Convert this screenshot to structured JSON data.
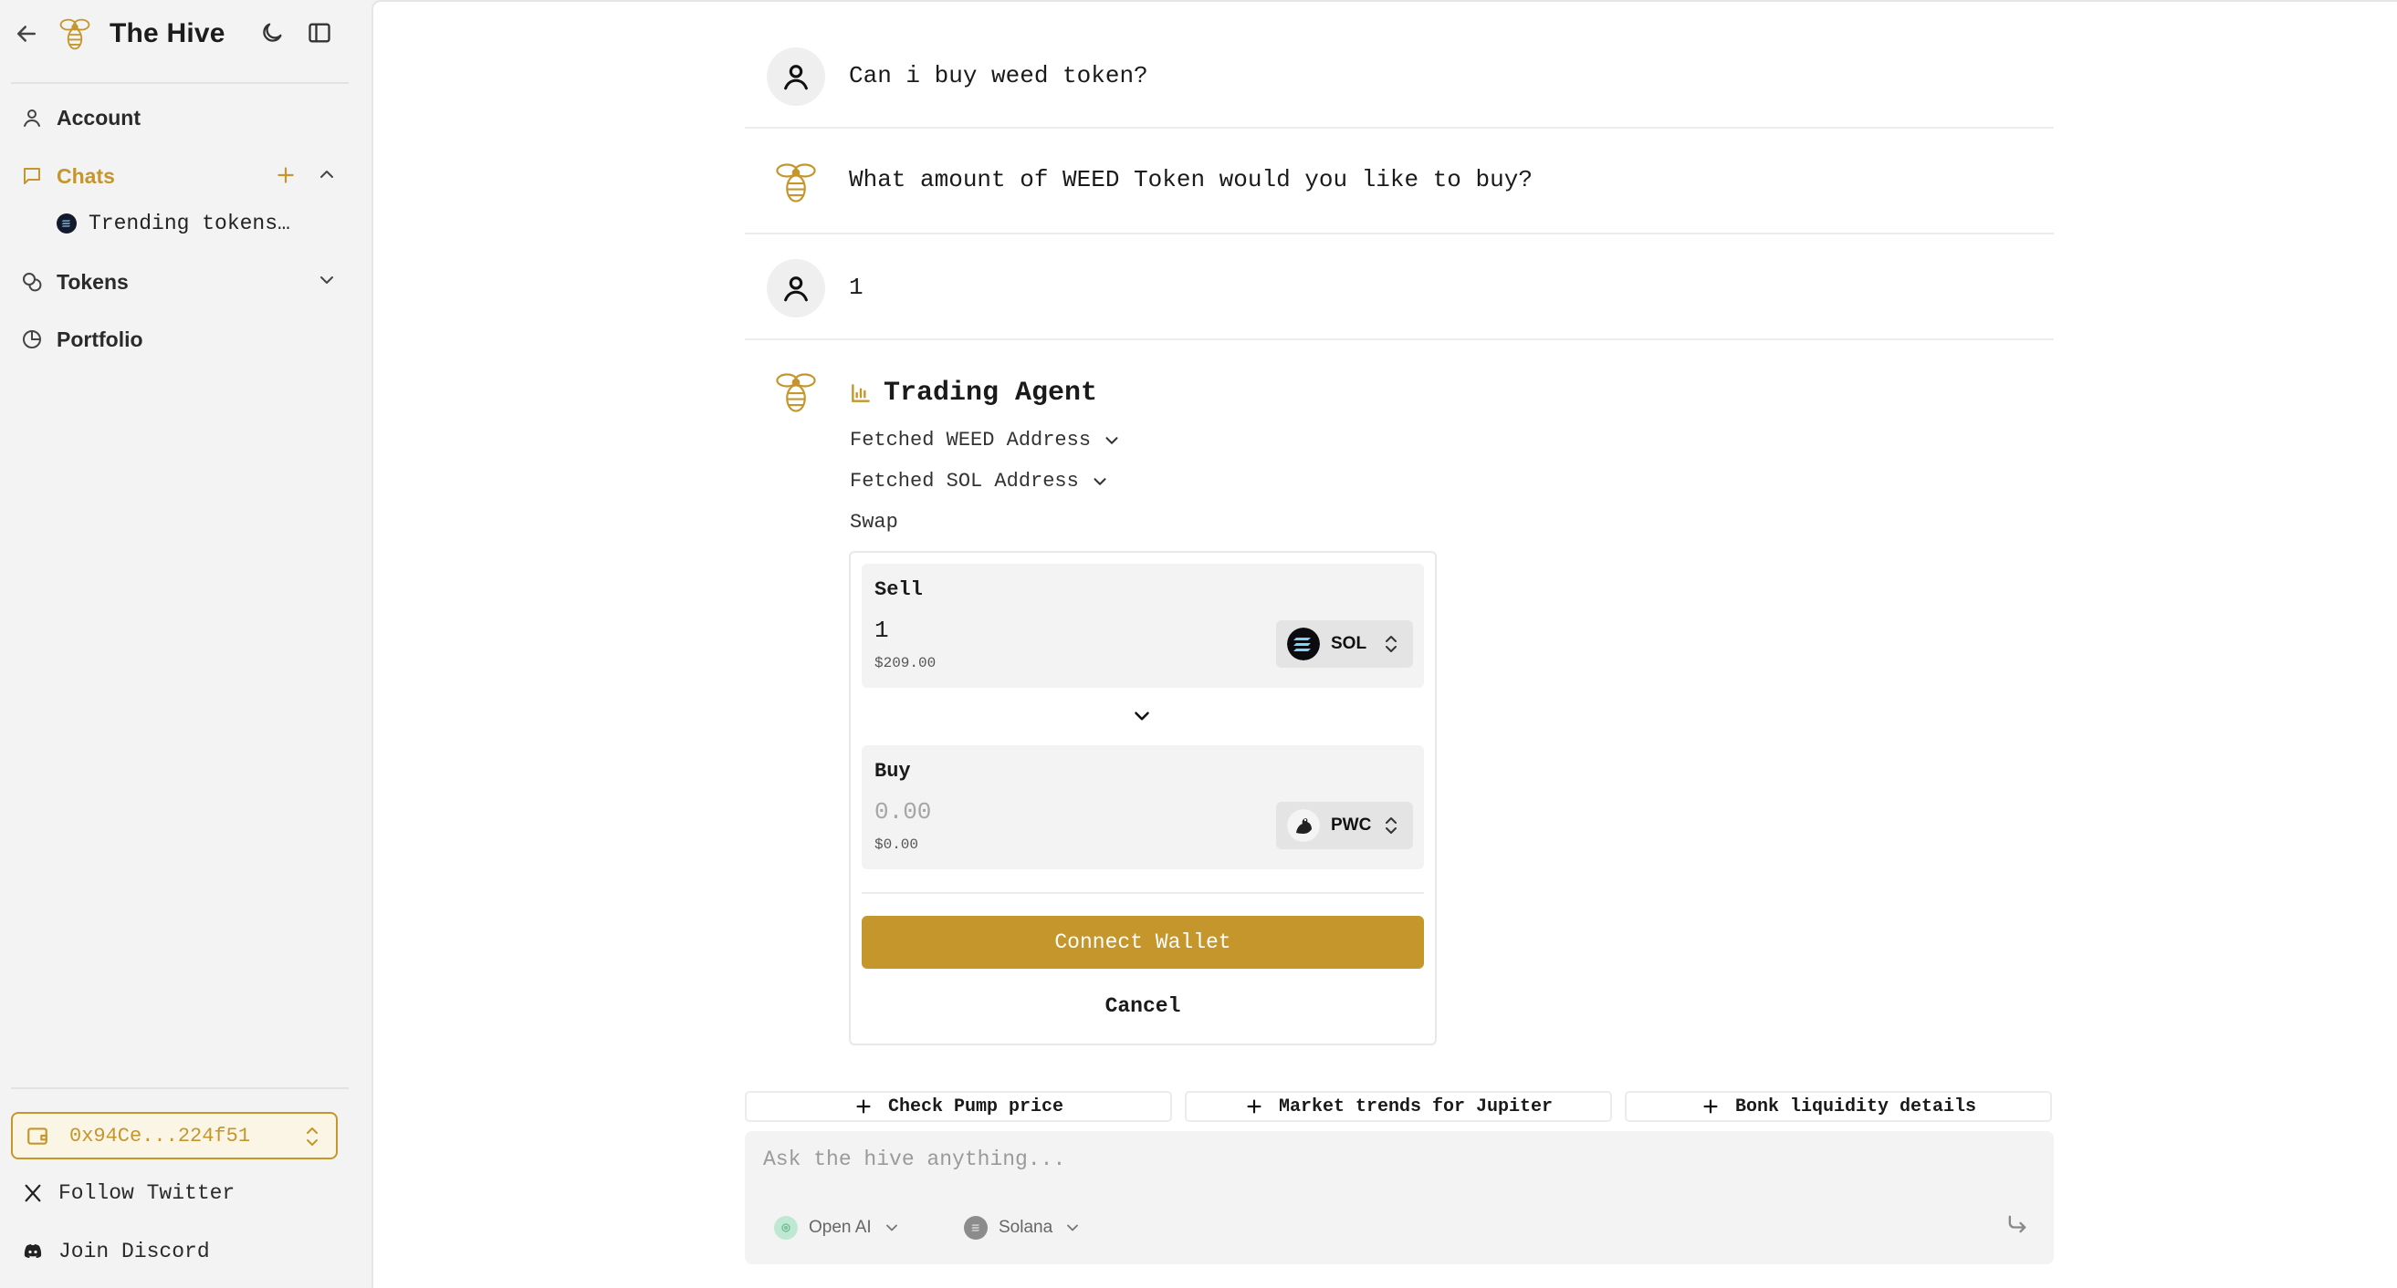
{
  "app": {
    "title": "The Hive"
  },
  "sidebar": {
    "nav": {
      "account": "Account",
      "chats": "Chats",
      "tokens": "Tokens",
      "portfolio": "Portfolio"
    },
    "chat_items": [
      {
        "label": "Trending tokens…"
      }
    ],
    "wallet": {
      "address": "0x94Ce...224f51"
    },
    "footer": {
      "twitter": "Follow Twitter",
      "discord": "Join Discord"
    }
  },
  "conversation": {
    "messages": [
      {
        "role": "user",
        "text": "Can i buy weed token?"
      },
      {
        "role": "assistant",
        "text": "What amount of WEED Token would you like to buy?"
      },
      {
        "role": "user",
        "text": "1"
      }
    ],
    "agent": {
      "title": "Trading Agent",
      "steps": [
        "Fetched WEED Address",
        "Fetched SOL Address"
      ],
      "swap_label": "Swap",
      "swap": {
        "sell": {
          "label": "Sell",
          "amount": "1",
          "usd": "$209.00",
          "token": "SOL"
        },
        "buy": {
          "label": "Buy",
          "amount_placeholder": "0.00",
          "usd": "$0.00",
          "token": "PWC"
        },
        "connect_label": "Connect Wallet",
        "cancel_label": "Cancel"
      }
    }
  },
  "suggestions": [
    "Check Pump price",
    "Market trends for Jupiter",
    "Bonk liquidity details"
  ],
  "composer": {
    "placeholder": "Ask the hive anything...",
    "model": "Open AI",
    "chain": "Solana"
  },
  "colors": {
    "accent": "#c4962c",
    "sidebar_bg": "#f3f3f3",
    "main_bg": "#ffffff"
  },
  "icons": [
    "arrow-left-icon",
    "bee-logo-icon",
    "moon-icon",
    "sidebar-panel-icon",
    "user-icon",
    "chat-bubble-icon",
    "plus-icon",
    "chevron-up-icon",
    "chevron-down-icon",
    "coins-icon",
    "pie-chart-icon",
    "wallet-icon",
    "x-logo-icon",
    "discord-icon",
    "chart-icon",
    "send-icon"
  ]
}
